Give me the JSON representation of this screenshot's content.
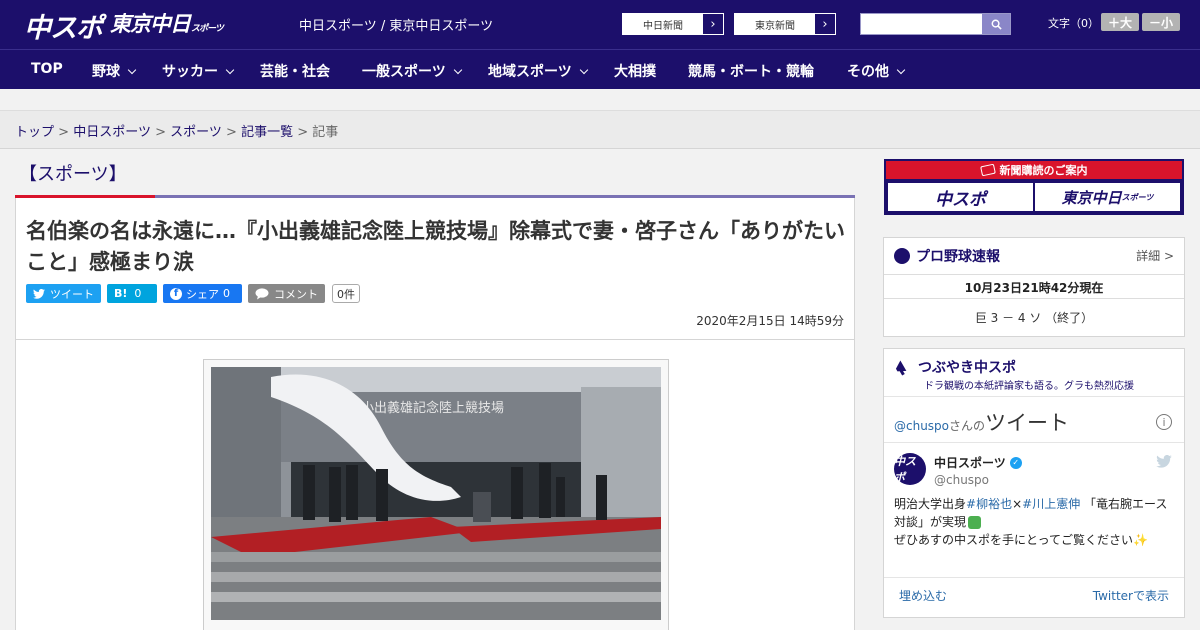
{
  "header": {
    "logo_chuspo": "中スポ",
    "logo_tokyo": "東京中日",
    "logo_tokyo_sub": "スポーツ",
    "tagline": "中日スポーツ / 東京中日スポーツ",
    "paper_links": [
      "中日新聞",
      "東京新聞"
    ],
    "font_size_label": "文字（0）",
    "font_bigger": "＋大",
    "font_smaller": "－小"
  },
  "nav": {
    "items": [
      "TOP",
      "野球",
      "サッカー",
      "芸能・社会",
      "一般スポーツ",
      "地域スポーツ",
      "大相撲",
      "競馬・ボート・競輪",
      "その他"
    ]
  },
  "breadcrumb": {
    "links": [
      "トップ",
      "中日スポーツ",
      "スポーツ",
      "記事一覧"
    ],
    "current": "記事",
    "separator": ">"
  },
  "article": {
    "section": "【スポーツ】",
    "title": "名伯楽の名は永遠に…『小出義雄記念陸上競技場』除幕式で妻・啓子さん「ありがたいこと」感極まり涙",
    "share": {
      "tweet": "ツイート",
      "hatena": "B!",
      "hatena_count": "0",
      "facebook": "シェア",
      "facebook_count": "0",
      "comment": "コメント",
      "comment_count": "0件"
    },
    "date": "2020年2月15日 14時59分",
    "photo_sign": "小出義雄記念陸上競技場"
  },
  "sidebar": {
    "ad": {
      "header": "新聞購読のご案内",
      "left": "中スポ",
      "right": "東京中日",
      "right_sub": "スポーツ"
    },
    "baseball": {
      "title": "プロ野球速報",
      "detail": "詳細 >",
      "as_of": "10月23日21時42分現在",
      "score": "巨 3 － 4 ソ （終了）"
    },
    "twitter_box": {
      "title": "つぶやき中スポ",
      "subtitle": "ドラ観戦の本紙評論家も語る。グラも熱烈応援",
      "handle_line_handle": "@chuspo",
      "handle_line_suffix": "さんの",
      "handle_line_big": "ツイート",
      "account_name": "中日スポーツ",
      "account_handle": "@chuspo",
      "account_logo": "中スポ",
      "tweet_pre": "明治大学出身",
      "tweet_tag1": "#柳裕也",
      "tweet_x": "×",
      "tweet_tag2": "#川上憲伸",
      "tweet_mid": "「竜右腕エース対談」が実現",
      "tweet_line2": "ぜひあすの中スポを手にとってご覧ください",
      "embed": "埋め込む",
      "view": "Twitterで表示"
    }
  },
  "colors": {
    "brand_navy": "#1c0f6b",
    "accent_red": "#d9142b",
    "twitter_blue": "#1da1f2",
    "facebook_blue": "#1877f2",
    "hatena_blue": "#00a4de"
  }
}
